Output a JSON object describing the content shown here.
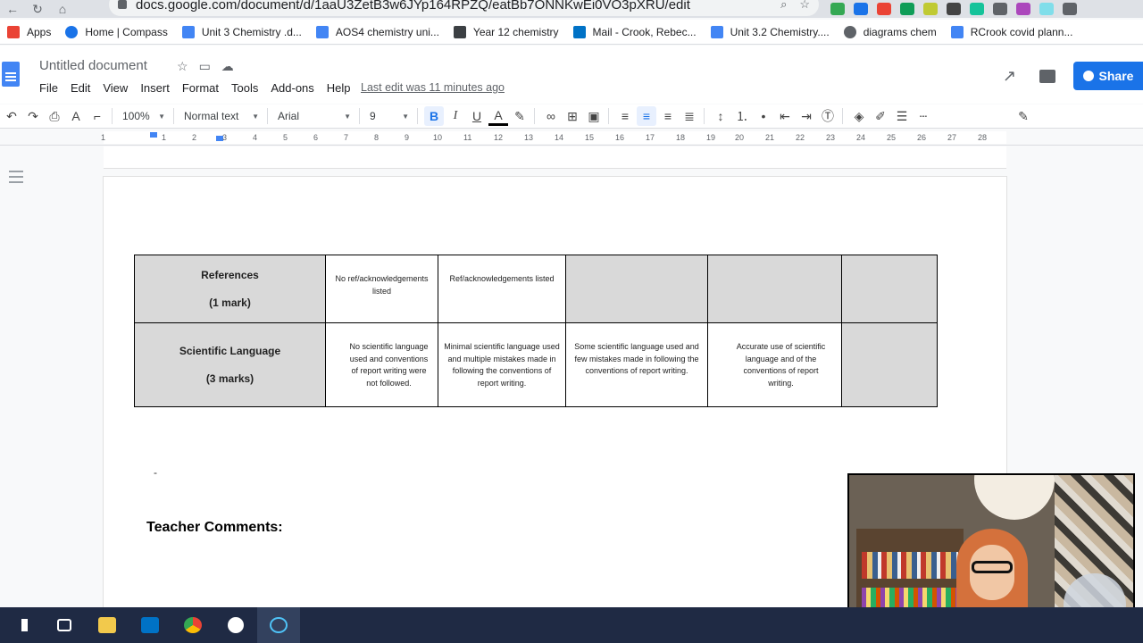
{
  "browser": {
    "url": "docs.google.com/document/d/1aaU3ZetB3w6JYp164RPZQ/eatBb7ONNKwEi0VO3pXRU/edit"
  },
  "bookmarks": [
    {
      "label": "Apps",
      "icon": "apps-grid-icon",
      "color": "#ea4335"
    },
    {
      "label": "Home | Compass",
      "icon": "compass-icon",
      "color": "#1a73e8"
    },
    {
      "label": "Unit 3 Chemistry .d...",
      "icon": "docs-icon",
      "color": "#4285f4"
    },
    {
      "label": "AOS4 chemistry uni...",
      "icon": "docs-icon",
      "color": "#4285f4"
    },
    {
      "label": "Year 12 chemistry",
      "icon": "classroom-icon",
      "color": "#3c4043"
    },
    {
      "label": "Mail - Crook, Rebec...",
      "icon": "outlook-icon",
      "color": "#0072c6"
    },
    {
      "label": "Unit 3.2 Chemistry....",
      "icon": "docs-icon",
      "color": "#4285f4"
    },
    {
      "label": "diagrams chem",
      "icon": "globe-icon",
      "color": "#5f6368"
    },
    {
      "label": "RCrook covid plann...",
      "icon": "docs-icon",
      "color": "#4285f4"
    }
  ],
  "docs": {
    "title": "Untitled document",
    "menus": [
      "File",
      "Edit",
      "View",
      "Insert",
      "Format",
      "Tools",
      "Add-ons",
      "Help"
    ],
    "last_edit": "Last edit was 11 minutes ago",
    "share_label": "Share"
  },
  "toolbar": {
    "zoom": "100%",
    "style": "Normal text",
    "font": "Arial",
    "size": "9",
    "bold": "B",
    "italic": "I",
    "underline": "U",
    "text_color": "A"
  },
  "ruler": {
    "numbers": [
      "1",
      "1",
      "2",
      "3",
      "4",
      "5",
      "6",
      "7",
      "8",
      "9",
      "10",
      "11",
      "12",
      "13",
      "14",
      "15",
      "16",
      "17",
      "18",
      "19",
      "20",
      "21",
      "22",
      "23",
      "24",
      "25",
      "26",
      "27",
      "28"
    ]
  },
  "rubric": {
    "rows": [
      {
        "criterion": "References",
        "marks": "(1 mark)",
        "cells": [
          "No ref/acknowledgements listed",
          "Ref/acknowledgements listed",
          "",
          "",
          ""
        ]
      },
      {
        "criterion": "Scientific Language",
        "marks": "(3 marks)",
        "cells": [
          "No scientific language used and conventions of report writing were not followed.",
          "Minimal scientific language used and multiple mistakes made in following the conventions of report writing.",
          "Some scientific language used and few mistakes made in following the conventions of report writing.",
          "Accurate use of scientific language and of the conventions of report writing.",
          ""
        ]
      }
    ]
  },
  "doc_body": {
    "dash": "-",
    "teacher_comments": "Teacher Comments:"
  }
}
